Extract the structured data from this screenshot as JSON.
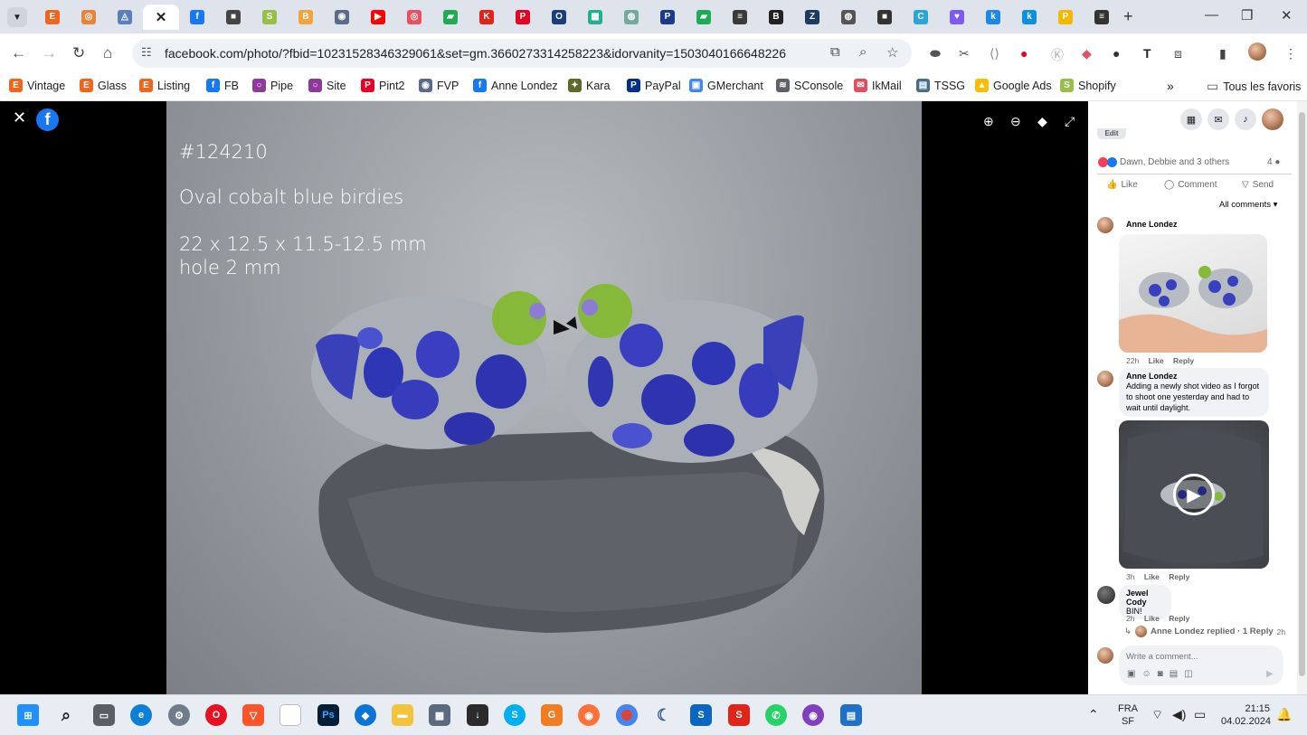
{
  "browser": {
    "tabs": [
      {
        "icon": "E",
        "color": "#f1641e"
      },
      {
        "icon": "◎",
        "color": "#e8833a"
      },
      {
        "icon": "◬",
        "color": "#5b7fb8"
      },
      {
        "icon": "✕",
        "color": "#202124",
        "active": true
      },
      {
        "icon": "f",
        "color": "#1877f2"
      },
      {
        "icon": "■",
        "color": "#444444"
      },
      {
        "icon": "S",
        "color": "#95bf47"
      },
      {
        "icon": "B",
        "color": "#f4a23c"
      },
      {
        "icon": "◉",
        "color": "#5a6b8a"
      },
      {
        "icon": "▶",
        "color": "#ff0000"
      },
      {
        "icon": "◎",
        "color": "#e94f5d"
      },
      {
        "icon": "▰",
        "color": "#1fab54"
      },
      {
        "icon": "K",
        "color": "#e2231a"
      },
      {
        "icon": "P",
        "color": "#e60023"
      },
      {
        "icon": "O",
        "color": "#1a3d7c"
      },
      {
        "icon": "▦",
        "color": "#20b08f"
      },
      {
        "icon": "◍",
        "color": "#74aa9c"
      },
      {
        "icon": "P",
        "color": "#1d3a8a"
      },
      {
        "icon": "▰",
        "color": "#1fab54"
      },
      {
        "icon": "≡",
        "color": "#3a3a3a"
      },
      {
        "icon": "B",
        "color": "#222222"
      },
      {
        "icon": "Z",
        "color": "#1f3a5f"
      },
      {
        "icon": "◍",
        "color": "#555555"
      },
      {
        "icon": "■",
        "color": "#333333"
      },
      {
        "icon": "C",
        "color": "#2aa6d6"
      },
      {
        "icon": "♥",
        "color": "#7f5af0"
      },
      {
        "icon": "k",
        "color": "#1e88e5"
      },
      {
        "icon": "k",
        "color": "#0f8fe0"
      },
      {
        "icon": "P",
        "color": "#f5b800"
      },
      {
        "icon": "≡",
        "color": "#333333"
      }
    ],
    "new_tab": "+",
    "url": "facebook.com/photo/?fbid=10231528346329061&set=gm.3660273314258223&idorvanity=1503040166648226"
  },
  "bookmarks": [
    {
      "label": "Vintage",
      "icon": "E",
      "color": "#f1641e"
    },
    {
      "label": "Glass",
      "icon": "E",
      "color": "#f1641e"
    },
    {
      "label": "Listing",
      "icon": "E",
      "color": "#f1641e"
    },
    {
      "label": "FB",
      "icon": "f",
      "color": "#1877f2"
    },
    {
      "label": "Pipe",
      "icon": "○",
      "color": "#8e3a9b"
    },
    {
      "label": "Site",
      "icon": "○",
      "color": "#8e3a9b"
    },
    {
      "label": "Pint2",
      "icon": "P",
      "color": "#e60023"
    },
    {
      "label": "FVP",
      "icon": "◉",
      "color": "#5a6b8a"
    },
    {
      "label": "Anne Londez",
      "icon": "f",
      "color": "#1877f2"
    },
    {
      "label": "Kara",
      "icon": "✦",
      "color": "#5c6b2a"
    },
    {
      "label": "PayPal",
      "icon": "P",
      "color": "#003087"
    },
    {
      "label": "GMerchant",
      "icon": "▣",
      "color": "#4285f4"
    },
    {
      "label": "SConsole",
      "icon": "≋",
      "color": "#5f6368"
    },
    {
      "label": "IkMail",
      "icon": "✉",
      "color": "#e04f5f"
    },
    {
      "label": "TSSG",
      "icon": "▤",
      "color": "#4a6c8c"
    },
    {
      "label": "Google Ads",
      "icon": "▲",
      "color": "#fbbc04"
    },
    {
      "label": "Shopify",
      "icon": "S",
      "color": "#95bf47"
    }
  ],
  "bookmarks_more": "»",
  "all_bookmarks": "Tous les favoris",
  "photo": {
    "line1": "#124210",
    "line2": "Oval cobalt blue birdies",
    "line3": "22 x 12.5 x 11.5-12.5 mm",
    "line4": "hole 2 mm"
  },
  "panel": {
    "edit": "Edit",
    "reactions": "Dawn, Debbie and 3 others",
    "comment_count": "4",
    "like": "Like",
    "comment": "Comment",
    "send": "Send",
    "all_comments": "All comments",
    "comments": [
      {
        "name": "Anne Londez",
        "time": "22h",
        "like": "Like",
        "reply": "Reply"
      },
      {
        "name": "Anne Londez",
        "text": "Adding a newly shot video as I forgot to shoot one yesterday and had to wait until daylight.",
        "time": "3h",
        "like": "Like",
        "reply": "Reply"
      },
      {
        "name": "Jewel Cody",
        "text": "BIN!",
        "time": "2h",
        "like": "Like",
        "reply": "Reply"
      }
    ],
    "reply_summary": "Anne Londez replied · 1 Reply",
    "reply_time": "2h",
    "write_placeholder": "Write a comment..."
  },
  "taskbar": {
    "lang": "FRA",
    "layout": "SF",
    "time": "21:15",
    "date": "04.02.2024"
  },
  "colors": {
    "facebook_blue": "#1877f2",
    "tabstrip": "#dfe3eb",
    "taskbar": "#e8edf3"
  }
}
